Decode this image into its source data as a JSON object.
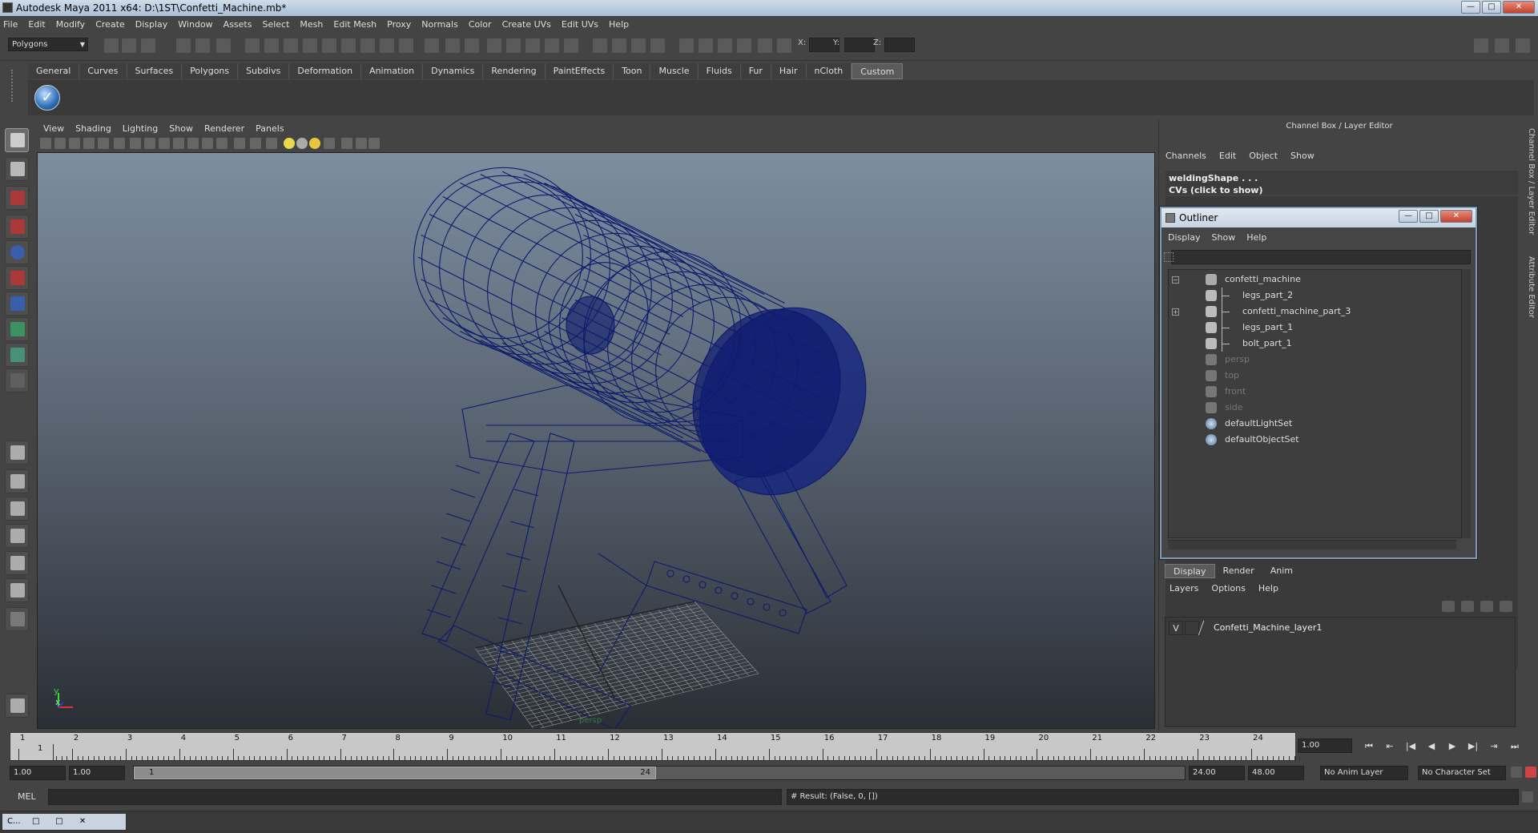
{
  "window": {
    "title": "Autodesk Maya 2011 x64: D:\\1ST\\Confetti_Machine.mb*"
  },
  "menubar": [
    "File",
    "Edit",
    "Modify",
    "Create",
    "Display",
    "Window",
    "Assets",
    "Select",
    "Mesh",
    "Edit Mesh",
    "Proxy",
    "Normals",
    "Color",
    "Create UVs",
    "Edit UVs",
    "Help"
  ],
  "toolbar": {
    "mode": "Polygons",
    "x_label": "X:",
    "y_label": "Y:",
    "z_label": "Z:"
  },
  "shelf_tabs": [
    "General",
    "Curves",
    "Surfaces",
    "Polygons",
    "Subdivs",
    "Deformation",
    "Animation",
    "Dynamics",
    "Rendering",
    "PaintEffects",
    "Toon",
    "Muscle",
    "Fluids",
    "Fur",
    "Hair",
    "nCloth",
    "Custom"
  ],
  "shelf_active": "Custom",
  "viewport": {
    "menu": [
      "View",
      "Shading",
      "Lighting",
      "Show",
      "Renderer",
      "Panels"
    ],
    "camera": "persp",
    "axis_x": "x",
    "axis_y": "y"
  },
  "channel_box": {
    "title": "Channel Box / Layer Editor",
    "menu": [
      "Channels",
      "Edit",
      "Object",
      "Show"
    ],
    "shape_name": "weldingShape . . .",
    "cvs_hint": "CVs (click to show)"
  },
  "side_tabs": [
    "Channel Box / Layer Editor",
    "Attribute Editor"
  ],
  "outliner": {
    "title": "Outliner",
    "menu": [
      "Display",
      "Show",
      "Help"
    ],
    "items": [
      {
        "label": "confetti_machine",
        "level": 0,
        "expand": "−",
        "icon": "transform-icon",
        "dim": false
      },
      {
        "label": "legs_part_2",
        "level": 1,
        "expand": "",
        "icon": "mesh-icon",
        "dim": false
      },
      {
        "label": "confetti_machine_part_3",
        "level": 1,
        "expand": "+",
        "icon": "mesh-icon",
        "dim": false
      },
      {
        "label": "legs_part_1",
        "level": 1,
        "expand": "",
        "icon": "mesh-icon",
        "dim": false
      },
      {
        "label": "bolt_part_1",
        "level": 1,
        "expand": "",
        "icon": "mesh-icon",
        "dim": false
      },
      {
        "label": "persp",
        "level": 0,
        "expand": "",
        "icon": "camera-icon",
        "dim": true
      },
      {
        "label": "top",
        "level": 0,
        "expand": "",
        "icon": "camera-icon",
        "dim": true
      },
      {
        "label": "front",
        "level": 0,
        "expand": "",
        "icon": "camera-icon",
        "dim": true
      },
      {
        "label": "side",
        "level": 0,
        "expand": "",
        "icon": "camera-icon",
        "dim": true
      },
      {
        "label": "defaultLightSet",
        "level": 0,
        "expand": "",
        "icon": "set-icon",
        "dim": false
      },
      {
        "label": "defaultObjectSet",
        "level": 0,
        "expand": "",
        "icon": "set-icon",
        "dim": false
      }
    ]
  },
  "layer_editor": {
    "tabs": [
      "Display",
      "Render",
      "Anim"
    ],
    "active_tab": "Display",
    "menu": [
      "Layers",
      "Options",
      "Help"
    ],
    "layers": [
      {
        "visible": "V",
        "name": "Confetti_Machine_layer1"
      }
    ]
  },
  "timeline": {
    "frames": [
      "1",
      "2",
      "3",
      "4",
      "5",
      "6",
      "7",
      "8",
      "9",
      "10",
      "11",
      "12",
      "13",
      "14",
      "15",
      "16",
      "17",
      "18",
      "19",
      "20",
      "21",
      "22",
      "23",
      "24"
    ],
    "current_frame": "1.00",
    "current_tick_label": "1"
  },
  "range": {
    "start": "1.00",
    "anim_start": "1.00",
    "handle_start": "1",
    "handle_end": "24",
    "end": "24.00",
    "anim_end": "48.00",
    "anim_layer": "No Anim Layer",
    "character_set": "No Character Set"
  },
  "command": {
    "mel_label": "MEL",
    "result": "# Result: (False, 0, [])"
  },
  "taskbar": {
    "window_label": "C...",
    "restore": "□",
    "maximize": "□",
    "close": "✕"
  },
  "colors": {
    "wire": "#0d1b6e",
    "accent": "#7c9ab8",
    "background": "#444444"
  }
}
